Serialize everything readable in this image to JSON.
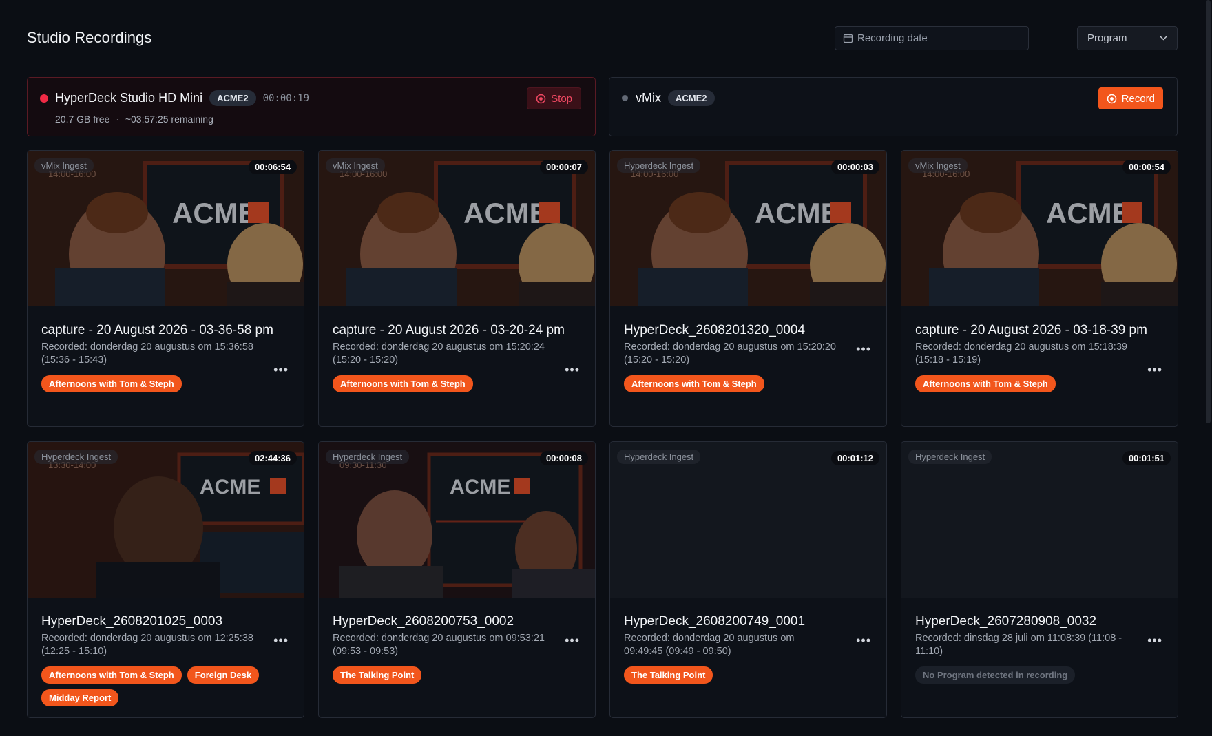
{
  "page": {
    "title": "Studio Recordings"
  },
  "filters": {
    "date_placeholder": "Recording date",
    "program_label": "Program"
  },
  "devices": [
    {
      "name": "HyperDeck Studio HD Mini",
      "studio": "ACME2",
      "timer": "00:00:19",
      "storage_free": "20.7 GB free",
      "storage_sep": "·",
      "storage_remaining": "~03:57:25 remaining",
      "status": "recording",
      "action_label": "Stop"
    },
    {
      "name": "vMix",
      "studio": "ACME2",
      "status": "idle",
      "action_label": "Record"
    }
  ],
  "recordings": [
    {
      "source": "vMix Ingest",
      "duration": "00:00:54",
      "title": "capture - 20 August 2026 - 03-18-39 pm",
      "meta": "Recorded: donderdag 20 augustus om 15:18:39 (15:18 - 15:19)",
      "tags": [
        "Afternoons with Tom & Steph"
      ]
    }
  ],
  "cards": [
    {
      "source": "vMix Ingest",
      "duration": "00:06:54",
      "title": "capture - 20 August 2026 - 03-36-58 pm",
      "meta": "Recorded: donderdag 20 augustus om 15:36:58 (15:36 - 15:43)",
      "tags": [
        "Afternoons with Tom & Steph"
      ],
      "thumb": "studio-duo"
    },
    {
      "source": "vMix Ingest",
      "duration": "00:00:07",
      "title": "capture - 20 August 2026 - 03-20-24 pm",
      "meta": "Recorded: donderdag 20 augustus om 15:20:24 (15:20 - 15:20)",
      "tags": [
        "Afternoons with Tom & Steph"
      ],
      "thumb": "studio-duo"
    },
    {
      "source": "Hyperdeck Ingest",
      "duration": "00:00:03",
      "title": "HyperDeck_2608201320_0004",
      "meta": "Recorded: donderdag 20 augustus om 15:20:20 (15:20 - 15:20)",
      "tags": [
        "Afternoons with Tom & Steph"
      ],
      "thumb": "studio-duo"
    },
    {
      "source": "vMix Ingest",
      "duration": "00:00:54",
      "title": "capture - 20 August 2026 - 03-18-39 pm",
      "meta": "Recorded: donderdag 20 augustus om 15:18:39 (15:18 - 15:19)",
      "tags": [
        "Afternoons with Tom & Steph"
      ],
      "thumb": "studio-duo"
    },
    {
      "source": "Hyperdeck Ingest",
      "duration": "02:44:36",
      "title": "HyperDeck_2608201025_0003",
      "meta": "Recorded: donderdag 20 augustus om 12:25:38 (12:25 - 15:10)",
      "tags": [
        "Afternoons with Tom & Steph",
        "Foreign Desk",
        "Midday Report"
      ],
      "thumb": "studio-solo"
    },
    {
      "source": "Hyperdeck Ingest",
      "duration": "00:00:08",
      "title": "HyperDeck_2608200753_0002",
      "meta": "Recorded: donderdag 20 augustus om 09:53:21 (09:53 - 09:53)",
      "tags": [
        "The Talking Point"
      ],
      "thumb": "studio-talk"
    },
    {
      "source": "Hyperdeck Ingest",
      "duration": "00:01:12",
      "title": "HyperDeck_2608200749_0001",
      "meta": "Recorded: donderdag 20 augustus om 09:49:45 (09:49 - 09:50)",
      "tags": [
        "The Talking Point"
      ],
      "thumb": "empty"
    },
    {
      "source": "Hyperdeck Ingest",
      "duration": "00:01:51",
      "title": "HyperDeck_2607280908_0032",
      "meta": "Recorded: dinsdag 28 juli om 11:08:39 (11:08 - 11:10)",
      "tags": [],
      "no_program": "No Program detected in recording",
      "thumb": "empty"
    }
  ],
  "thumb_overlay": {
    "slot_a": "14:00-16:00",
    "slot_b": "13:30-14:00",
    "slot_c": "09:30-11:30",
    "brand": "ACME"
  },
  "colors": {
    "accent": "#f2561c",
    "live": "#ef2a45",
    "background": "#0b0e14"
  },
  "icons": {
    "date": "calendar-icon",
    "program": "chevron-down-icon",
    "stop": "stop-circle-icon",
    "record": "record-circle-icon",
    "more": "more-horizontal-icon"
  }
}
